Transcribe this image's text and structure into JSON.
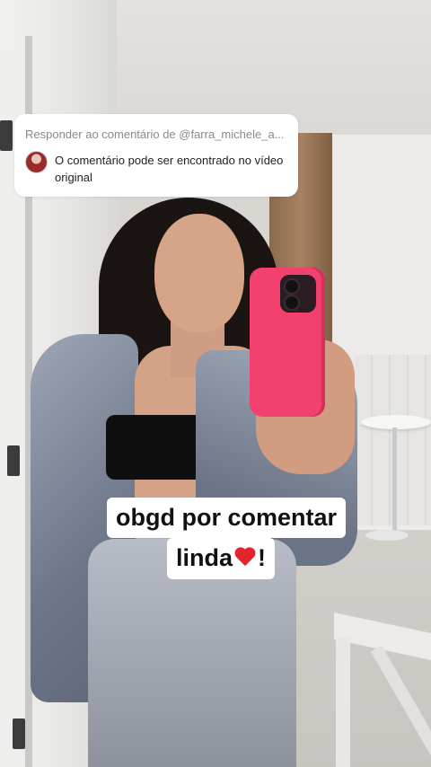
{
  "reply": {
    "header": "Responder ao comentário de @farra_michele_a...",
    "body": "O comentário pode ser encontrado no vídeo original"
  },
  "caption": {
    "line1": "obgd por comentar",
    "line2_text": "linda",
    "line2_suffix": "!",
    "heart_icon": "red-heart-icon"
  },
  "colors": {
    "phone_case": "#f2416e",
    "heart": "#e0262b"
  }
}
